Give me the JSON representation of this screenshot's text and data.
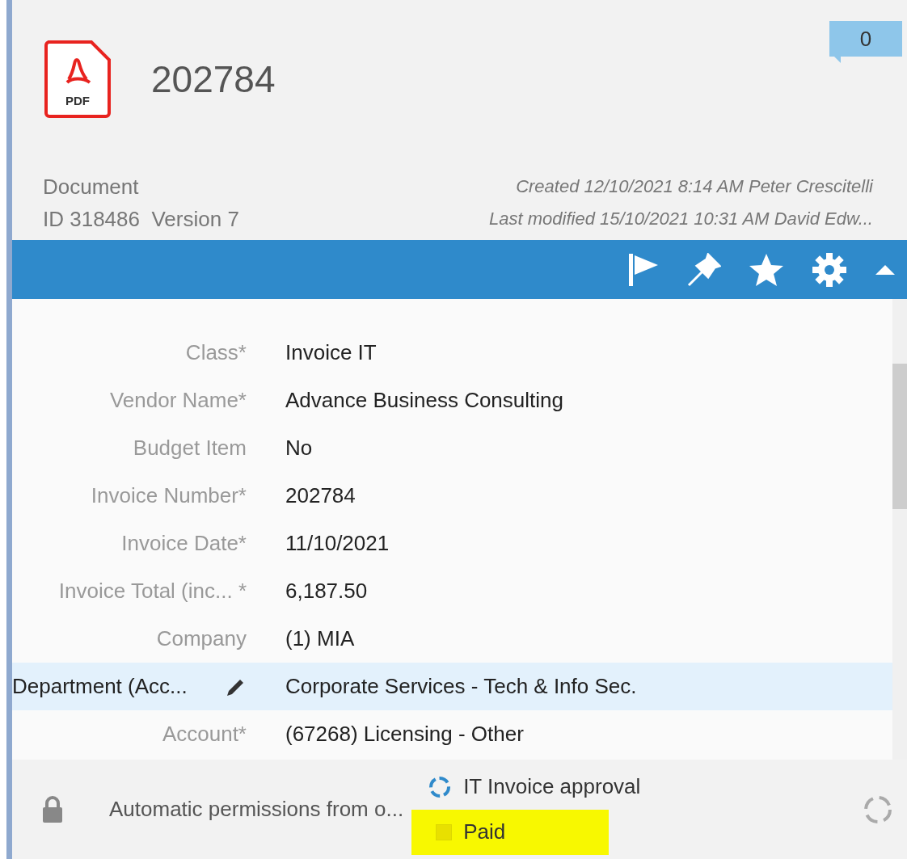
{
  "header": {
    "file_type": "PDF",
    "title": "202784",
    "comment_count": "0",
    "object_type": "Document",
    "id_version": "ID 318486  Version 7",
    "created": "Created 12/10/2021 8:14 AM Peter Crescitelli",
    "modified": "Last modified 15/10/2021 10:31 AM David Edw..."
  },
  "properties": [
    {
      "label": "Class*",
      "value": "Invoice IT",
      "selected": false
    },
    {
      "label": "Vendor Name*",
      "value": "Advance Business Consulting",
      "selected": false
    },
    {
      "label": "Budget Item",
      "value": "No",
      "selected": false
    },
    {
      "label": "Invoice Number*",
      "value": "202784",
      "selected": false
    },
    {
      "label": "Invoice Date*",
      "value": "11/10/2021",
      "selected": false
    },
    {
      "label": "Invoice Total (inc... *",
      "value": "6,187.50",
      "selected": false
    },
    {
      "label": "Company",
      "value": "(1) MIA",
      "selected": false
    },
    {
      "label": "Department (Acc...",
      "value": "Corporate Services - Tech & Info Sec.",
      "selected": true
    },
    {
      "label": "Account*",
      "value": "(67268) Licensing - Other",
      "selected": false
    }
  ],
  "footer": {
    "permissions": "Automatic permissions from o...",
    "workflow": "IT Invoice approval",
    "state": "Paid",
    "state_highlighted": true
  }
}
